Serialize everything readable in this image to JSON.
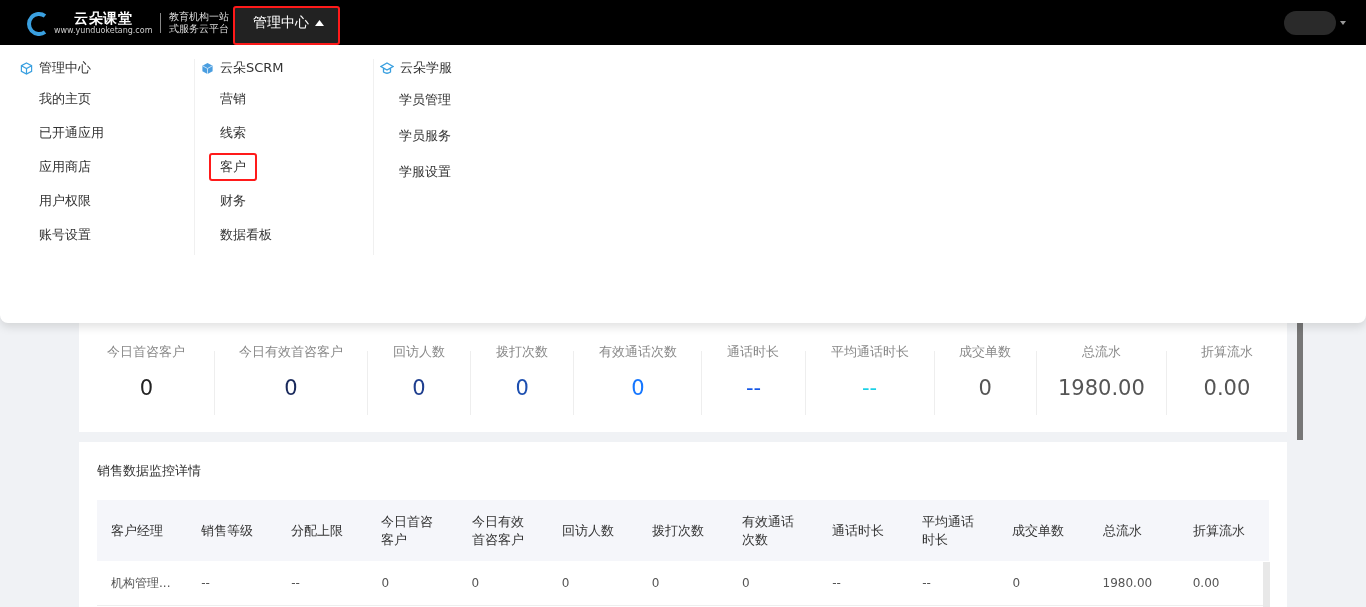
{
  "topbar": {
    "logo": {
      "name": "云朵课堂",
      "url": "www.yunduoketang.com",
      "tagline": [
        "教育机构一站",
        "式服务云平台"
      ]
    },
    "nav": [
      {
        "label": "管理中心",
        "selected": true,
        "expanded": true,
        "highlighted": true
      }
    ]
  },
  "menu": {
    "groups": [
      {
        "title": "管理中心",
        "items": [
          {
            "label": "我的主页",
            "highlighted": false
          },
          {
            "label": "已开通应用",
            "highlighted": false
          },
          {
            "label": "应用商店",
            "highlighted": false
          },
          {
            "label": "用户权限",
            "highlighted": false
          },
          {
            "label": "账号设置",
            "highlighted": false
          }
        ]
      },
      {
        "title": "云朵SCRM",
        "items": [
          {
            "label": "营销",
            "highlighted": false
          },
          {
            "label": "线索",
            "highlighted": false
          },
          {
            "label": "客户",
            "highlighted": true
          },
          {
            "label": "财务",
            "highlighted": false
          },
          {
            "label": "数据看板",
            "highlighted": false
          }
        ]
      },
      {
        "title": "云朵学服",
        "items": [
          {
            "label": "学员管理",
            "highlighted": false
          },
          {
            "label": "学员服务",
            "highlighted": false
          },
          {
            "label": "学服设置",
            "highlighted": false
          }
        ]
      }
    ]
  },
  "stats": [
    {
      "label": "今日首咨客户",
      "value": "0",
      "color": "#222222"
    },
    {
      "label": "今日有效首咨客户",
      "value": "0",
      "color": "#1a2a5c"
    },
    {
      "label": "回访人数",
      "value": "0",
      "color": "#1f3f8f"
    },
    {
      "label": "拨打次数",
      "value": "0",
      "color": "#1d4fb0"
    },
    {
      "label": "有效通话次数",
      "value": "0",
      "color": "#1677ff"
    },
    {
      "label": "通话时长",
      "value": "--",
      "color": "#1456e6"
    },
    {
      "label": "平均通话时长",
      "value": "--",
      "color": "#1ad1e6"
    },
    {
      "label": "成交单数",
      "value": "0",
      "color": "#555555"
    },
    {
      "label": "总流水",
      "value": "1980.00",
      "color": "#555555"
    },
    {
      "label": "折算流水",
      "value": "0.00",
      "color": "#555555"
    }
  ],
  "detail": {
    "title": "销售数据监控详情",
    "table": {
      "columns": [
        "客户经理",
        "销售等级",
        "分配上限",
        "今日首咨客户",
        "今日有效首咨客户",
        "回访人数",
        "拨打次数",
        "有效通话次数",
        "通话时长",
        "平均通话时长",
        "成交单数",
        "总流水",
        "折算流水"
      ],
      "rows": [
        [
          "机构管理...",
          "--",
          "--",
          "0",
          "0",
          "0",
          "0",
          "0",
          "--",
          "--",
          "0",
          "1980.00",
          "0.00"
        ]
      ]
    }
  }
}
